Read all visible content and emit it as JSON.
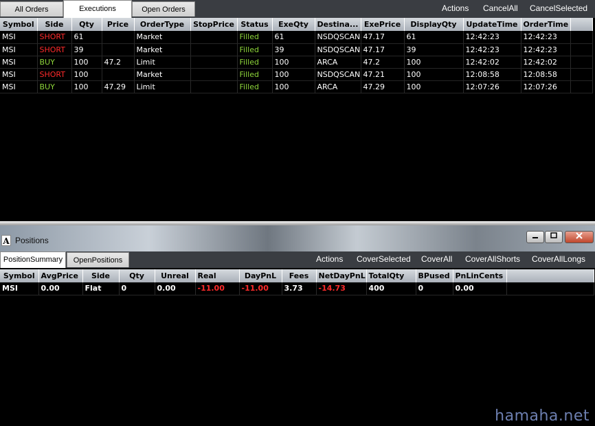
{
  "orders": {
    "tabs": [
      "All Orders",
      "Executions",
      "Open Orders"
    ],
    "active_tab": "Executions",
    "actions": [
      "Actions",
      "CancelAll",
      "CancelSelected"
    ],
    "columns": [
      "Symbol",
      "Side",
      "Qty",
      "Price",
      "OrderType",
      "StopPrice",
      "Status",
      "ExeQty",
      "Destina...",
      "ExePrice",
      "DisplayQty",
      "UpdateTime",
      "OrderTime"
    ],
    "rows": [
      [
        "MSI",
        "SHORT",
        "61",
        "",
        "Market",
        "",
        "Filled",
        "61",
        "NSDQSCAN",
        "47.17",
        "61",
        "12:42:23",
        "12:42:23"
      ],
      [
        "MSI",
        "SHORT",
        "39",
        "",
        "Market",
        "",
        "Filled",
        "39",
        "NSDQSCAN",
        "47.17",
        "39",
        "12:42:23",
        "12:42:23"
      ],
      [
        "MSI",
        "BUY",
        "100",
        "47.2",
        "Limit",
        "",
        "Filled",
        "100",
        "ARCA",
        "47.2",
        "100",
        "12:42:02",
        "12:42:02"
      ],
      [
        "MSI",
        "SHORT",
        "100",
        "",
        "Market",
        "",
        "Filled",
        "100",
        "NSDQSCAN",
        "47.21",
        "100",
        "12:08:58",
        "12:08:58"
      ],
      [
        "MSI",
        "BUY",
        "100",
        "47.29",
        "Limit",
        "",
        "Filled",
        "100",
        "ARCA",
        "47.29",
        "100",
        "12:07:26",
        "12:07:26"
      ]
    ]
  },
  "positions": {
    "window_title": "Positions",
    "title_icon": "A",
    "window_buttons": {
      "minimize": "minimize-icon",
      "maximize": "maximize-icon",
      "close": "close-icon"
    },
    "tabs": [
      "PositionSummary",
      "OpenPositions"
    ],
    "active_tab": "PositionSummary",
    "actions": [
      "Actions",
      "CoverSelected",
      "CoverAll",
      "CoverAllShorts",
      "CoverAllLongs"
    ],
    "columns": [
      "Symbol",
      "AvgPrice",
      "Side",
      "Qty",
      "Unreal",
      "Real",
      "DayPnL",
      "Fees",
      "NetDayPnL",
      "TotalQty",
      "BPused",
      "PnLinCents"
    ],
    "rows": [
      [
        "MSI",
        "0.00",
        "Flat",
        "0",
        "0.00",
        "-11.00",
        "-11.00",
        "3.73",
        "-14.73",
        "400",
        "0",
        "0.00"
      ]
    ]
  },
  "watermark": "hamaha.net",
  "colors": {
    "short": "#ff2a2a",
    "buy": "#8ed63a",
    "filled": "#8ed63a",
    "negative": "#ff2a2a",
    "grid_bg": "#000000"
  }
}
